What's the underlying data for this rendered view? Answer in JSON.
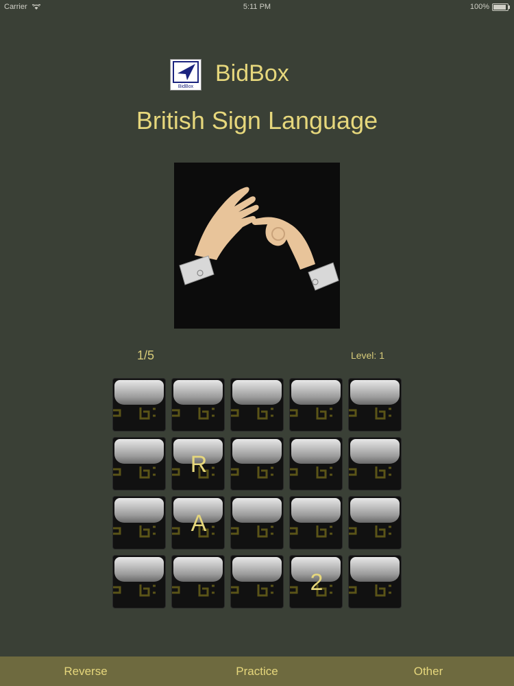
{
  "status_bar": {
    "carrier": "Carrier",
    "time": "5:11 PM",
    "battery": "100%"
  },
  "header": {
    "app_name": "BidBox",
    "logo_text": "BidBox",
    "title": "British Sign Language"
  },
  "quiz": {
    "progress": "1/5",
    "level": "Level: 1"
  },
  "tiles": [
    "",
    "",
    "",
    "",
    "",
    "",
    "R",
    "",
    "",
    "",
    "",
    "A",
    "",
    "",
    "",
    "",
    "",
    "",
    "2",
    ""
  ],
  "tab_bar": {
    "items": [
      "Reverse",
      "Practice",
      "Other"
    ]
  },
  "colors": {
    "background": "#3a4036",
    "accent_text": "#e6d77c",
    "tab_bar": "#6e6a3f"
  }
}
